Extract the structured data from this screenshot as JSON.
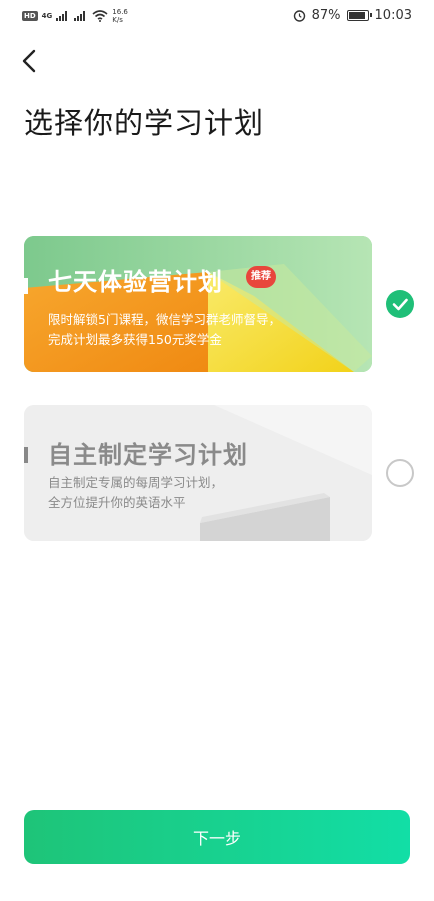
{
  "status_bar": {
    "hd": "HD",
    "network": "4G",
    "speed_value": "16.6",
    "speed_unit": "K/s",
    "battery_pct": "87%",
    "time": "10:03"
  },
  "header": {
    "back_icon": "chevron-left-icon",
    "title": "选择你的学习计划"
  },
  "plans": [
    {
      "title": "七天体验营计划",
      "badge": "推荐",
      "desc_line1": "限时解锁5门课程，微信学习群老师督导，",
      "desc_line2": "完成计划最多获得150元奖学金",
      "selected": true
    },
    {
      "title": "自主制定学习计划",
      "desc_line1": "自主制定专属的每周学习计划，",
      "desc_line2": "全方位提升你的英语水平",
      "selected": false
    }
  ],
  "footer": {
    "next_label": "下一步"
  },
  "colors": {
    "accent": "#1fbf78",
    "badge": "#e8463c",
    "card1_green": "#8ccf95",
    "card1_orange": "#f5a623",
    "card1_yellow": "#f7e24a"
  }
}
